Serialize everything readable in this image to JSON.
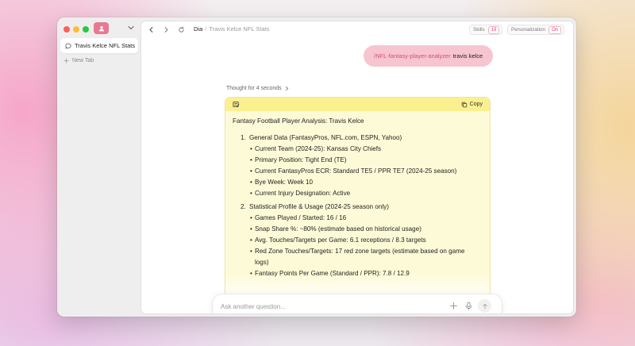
{
  "sidebar": {
    "tabs": [
      {
        "label": "Travis Kelce NFL Stats"
      }
    ],
    "new_tab_label": "New Tab"
  },
  "topbar": {
    "app_name": "Dia",
    "separator": "/",
    "page_title": "Travis Kelce NFL Stats",
    "skills_label": "Skills",
    "skills_count": "19",
    "personalization_label": "Personalization",
    "personalization_state": "On"
  },
  "chat": {
    "user_message": {
      "command": "/NFL-fantasy-player-analyzer",
      "argument": "travis kelce"
    },
    "thought_label": "Thought for 4 seconds",
    "card": {
      "copy_label": "Copy",
      "title": "Fantasy Football Player Analysis: Travis Kelce",
      "sections": [
        {
          "number": "1.",
          "heading": "General Data (FantasyPros, NFL.com, ESPN, Yahoo)",
          "bullets": [
            {
              "text": "Current Team (2024-25): Kansas City Chiefs"
            },
            {
              "text": "Primary Position: Tight End (TE)"
            },
            {
              "text": "Current FantasyPros ECR: Standard TE5 / PPR TE7 (2024-25 season)"
            },
            {
              "text": "Bye Week: Week 10"
            },
            {
              "text": "Current Injury Designation: Active"
            }
          ]
        },
        {
          "number": "2.",
          "heading": "Statistical Profile & Usage (2024-25 season only)",
          "bullets": [
            {
              "text": "Games Played / Started: 16 / 16"
            },
            {
              "text": "Snap Share %: ~80% (estimate based on historical usage)"
            },
            {
              "text": "Avg. Touches/Targets per Game: 6.1 receptions / 8.3 targets"
            },
            {
              "text": "Red Zone Touches/Targets: 17 red zone targets (estimate based on game",
              "cont": "logs)"
            },
            {
              "text": "Fantasy Points Per Game (Standard / PPR): 7.8 / 12.9"
            }
          ]
        }
      ]
    }
  },
  "ask_bar": {
    "placeholder": "Ask another question..."
  },
  "colors": {
    "accent": "#e0406a",
    "card_header": "#fbf08f",
    "card_body": "#fdfbd7",
    "user_bubble": "#f7c5cf"
  }
}
